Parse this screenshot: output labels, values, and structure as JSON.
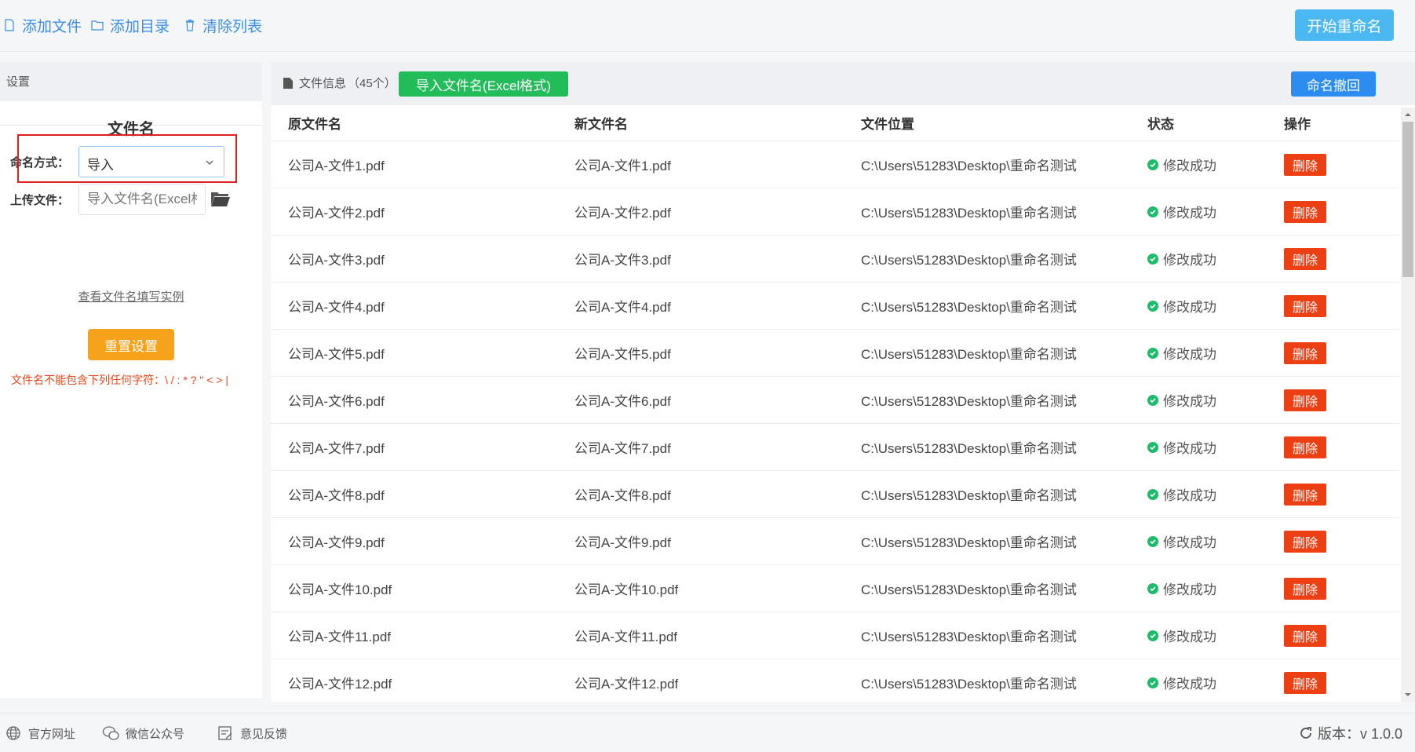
{
  "toolbar": {
    "add_file": "添加文件",
    "add_dir": "添加目录",
    "clear_list": "清除列表",
    "start_rename": "开始重命名"
  },
  "settings": {
    "header": "设置",
    "section_title": "文件名",
    "naming_mode_label": "命名方式：",
    "naming_mode_value": "导入",
    "upload_label": "上传文件：",
    "upload_placeholder": "导入文件名(Excel格式)",
    "example_link": "查看文件名填写实例",
    "reset_button": "重置设置",
    "warning": "文件名不能包含下列任何字符：\\ / : * ? \" < > |"
  },
  "file_panel": {
    "info_label": "文件信息",
    "count": "（45个）",
    "import_button": "导入文件名(Excel格式)",
    "undo_button": "命名撤回",
    "columns": [
      "原文件名",
      "新文件名",
      "文件位置",
      "状态",
      "操作"
    ],
    "rows": [
      {
        "orig": "公司A-文件1.pdf",
        "new": "公司A-文件1.pdf",
        "path": "C:\\Users\\51283\\Desktop\\重命名测试",
        "status": "修改成功",
        "action": "删除"
      },
      {
        "orig": "公司A-文件2.pdf",
        "new": "公司A-文件2.pdf",
        "path": "C:\\Users\\51283\\Desktop\\重命名测试",
        "status": "修改成功",
        "action": "删除"
      },
      {
        "orig": "公司A-文件3.pdf",
        "new": "公司A-文件3.pdf",
        "path": "C:\\Users\\51283\\Desktop\\重命名测试",
        "status": "修改成功",
        "action": "删除"
      },
      {
        "orig": "公司A-文件4.pdf",
        "new": "公司A-文件4.pdf",
        "path": "C:\\Users\\51283\\Desktop\\重命名测试",
        "status": "修改成功",
        "action": "删除"
      },
      {
        "orig": "公司A-文件5.pdf",
        "new": "公司A-文件5.pdf",
        "path": "C:\\Users\\51283\\Desktop\\重命名测试",
        "status": "修改成功",
        "action": "删除"
      },
      {
        "orig": "公司A-文件6.pdf",
        "new": "公司A-文件6.pdf",
        "path": "C:\\Users\\51283\\Desktop\\重命名测试",
        "status": "修改成功",
        "action": "删除"
      },
      {
        "orig": "公司A-文件7.pdf",
        "new": "公司A-文件7.pdf",
        "path": "C:\\Users\\51283\\Desktop\\重命名测试",
        "status": "修改成功",
        "action": "删除"
      },
      {
        "orig": "公司A-文件8.pdf",
        "new": "公司A-文件8.pdf",
        "path": "C:\\Users\\51283\\Desktop\\重命名测试",
        "status": "修改成功",
        "action": "删除"
      },
      {
        "orig": "公司A-文件9.pdf",
        "new": "公司A-文件9.pdf",
        "path": "C:\\Users\\51283\\Desktop\\重命名测试",
        "status": "修改成功",
        "action": "删除"
      },
      {
        "orig": "公司A-文件10.pdf",
        "new": "公司A-文件10.pdf",
        "path": "C:\\Users\\51283\\Desktop\\重命名测试",
        "status": "修改成功",
        "action": "删除"
      },
      {
        "orig": "公司A-文件11.pdf",
        "new": "公司A-文件11.pdf",
        "path": "C:\\Users\\51283\\Desktop\\重命名测试",
        "status": "修改成功",
        "action": "删除"
      },
      {
        "orig": "公司A-文件12.pdf",
        "new": "公司A-文件12.pdf",
        "path": "C:\\Users\\51283\\Desktop\\重命名测试",
        "status": "修改成功",
        "action": "删除"
      }
    ]
  },
  "footer": {
    "website": "官方网址",
    "wechat": "微信公众号",
    "feedback": "意见反馈",
    "version": "版本：v 1.0.0"
  },
  "colors": {
    "accent": "#3a8ee6",
    "start": "#4cb8f2",
    "excel": "#22bc5a",
    "undo": "#2d8cf0",
    "reset": "#f7a21b",
    "delete": "#ed3f14",
    "success": "#1dbb6a",
    "warning": "#e8471c"
  }
}
